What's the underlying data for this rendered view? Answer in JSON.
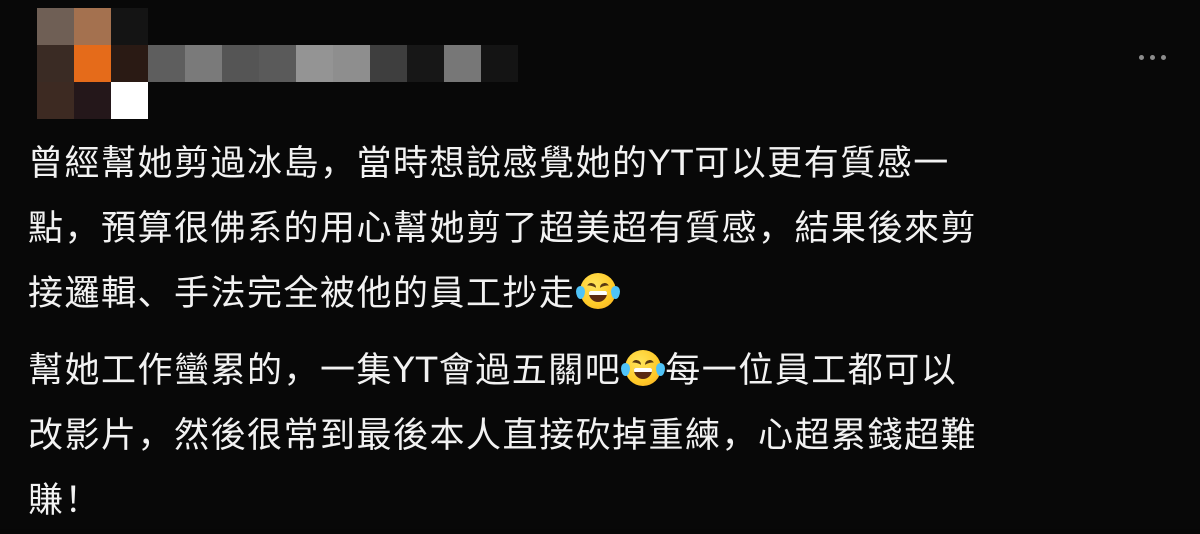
{
  "post": {
    "avatar": {
      "icon": "blurred-avatar",
      "pixels": [
        "#6f5f55",
        "#a4714f",
        "#141414",
        "#3a2b24",
        "#e56b1a",
        "#2a1a14",
        "#3d2a22",
        "#24171a",
        "#ffffff"
      ]
    },
    "username": {
      "blurred": true,
      "pixels": [
        "#5e5e5e",
        "#7a7a7a",
        "#555555",
        "#5a5a5a",
        "#949494",
        "#8e8e8e",
        "#3e3e3e",
        "#171717",
        "#777777",
        "#141414"
      ]
    },
    "more_button_icon": "more-horizontal-icon",
    "paragraphs": [
      {
        "lines": [
          "曾經幫她剪過冰島，當時想說感覺她的YT可以更有質感一",
          "點，預算很佛系的用心幫她剪了超美超有質感，結果後來剪",
          "接邏輯、手法完全被他的員工抄走"
        ],
        "emoji": "face-with-tears-of-joy-icon"
      },
      {
        "lines": [
          {
            "before_emoji": "幫她工作蠻累的，一集YT會過五關吧",
            "after_emoji": "每一位員工都可以"
          },
          "改影片，然後很常到最後本人直接砍掉重練，心超累錢超難",
          "賺！"
        ],
        "emoji": "face-with-tears-of-joy-icon"
      }
    ]
  }
}
